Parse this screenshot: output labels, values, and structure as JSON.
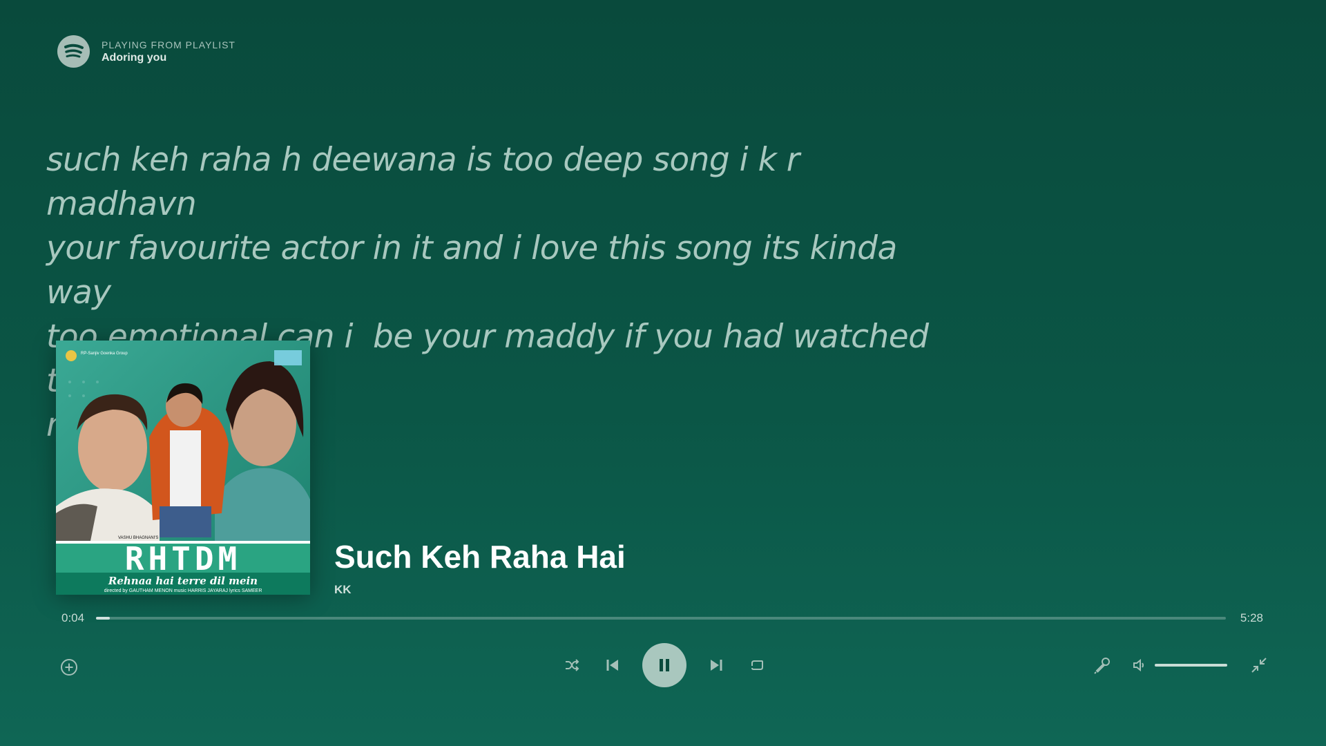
{
  "header": {
    "context_label": "PLAYING FROM PLAYLIST",
    "playlist_name": "Adoring you"
  },
  "lyrics": {
    "text": "such keh raha h deewana is too deep song i k r madhavn\nyour favourite actor in it and i love this song its kinda way\ntoo emotional can i  be your maddy if you had watched this\nmovie"
  },
  "album_art": {
    "title_logo": "RHTDM",
    "subtitle": "Rehnaa hai terre dil mein",
    "credits": "directed by GAUTHAM MENON  music HARRIS JAYARAJ  lyrics SAMEER",
    "label_top": "RP-Sanjiv Goenka Group",
    "producer": "VASHU BHAGNANI'S"
  },
  "track": {
    "title": "Such Keh Raha Hai",
    "artist": "KK"
  },
  "progress": {
    "elapsed": "0:04",
    "duration": "5:28",
    "fraction": 0.012
  },
  "volume": {
    "fraction": 1.0
  },
  "colors": {
    "background_top": "#094a3c",
    "background_bottom": "#0f6655",
    "accent": "#a9c7be"
  },
  "icons": {
    "logo": "spotify-logo-icon",
    "add": "add-circle-icon",
    "shuffle": "shuffle-icon",
    "previous": "skip-previous-icon",
    "play_pause": "pause-icon",
    "next": "skip-next-icon",
    "repeat": "repeat-icon",
    "lyrics": "microphone-icon",
    "volume": "volume-icon",
    "exit_fullscreen": "minimize-icon"
  }
}
